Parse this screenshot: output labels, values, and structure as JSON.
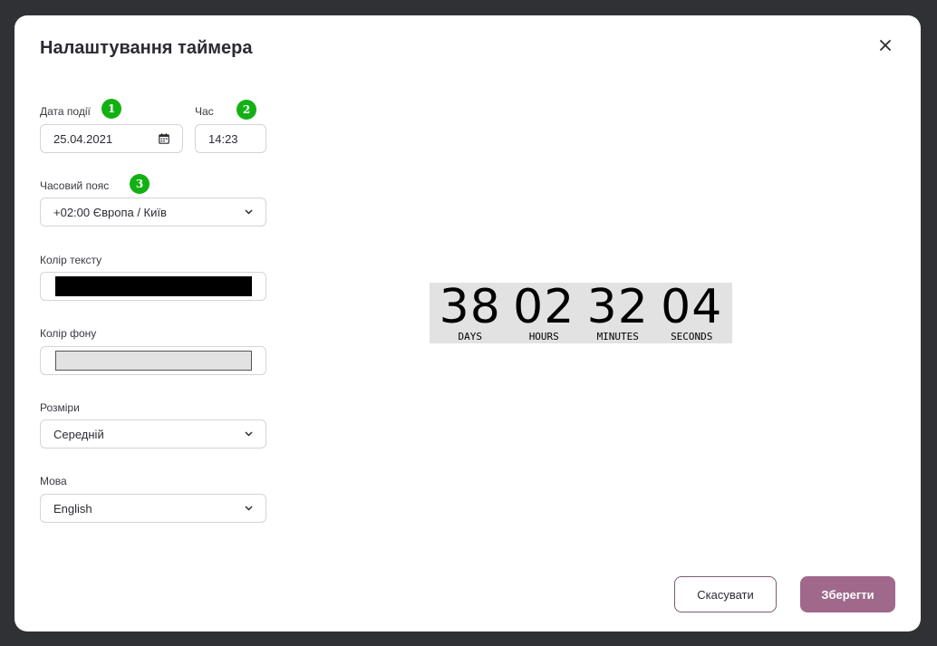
{
  "modal": {
    "title": "Налаштування таймера",
    "close_icon": "close-icon"
  },
  "form": {
    "date": {
      "label": "Дата події",
      "badge": "1",
      "value": "25.04.2021",
      "icon": "calendar-icon"
    },
    "time": {
      "label": "Час",
      "badge": "2",
      "value": "14:23"
    },
    "timezone": {
      "label": "Часовий пояс",
      "badge": "3",
      "value": "+02:00 Європа / Київ",
      "icon": "chevron-down-icon"
    },
    "text_color": {
      "label": "Колір тексту",
      "color": "#000000"
    },
    "bg_color": {
      "label": "Колір фону",
      "color": "#e2e2e2"
    },
    "size": {
      "label": "Розміри",
      "value": "Середній",
      "icon": "chevron-down-icon"
    },
    "language": {
      "label": "Мова",
      "value": "English",
      "icon": "chevron-down-icon"
    }
  },
  "preview": {
    "background": "#e2e2e2",
    "text_color": "#000000",
    "units": [
      {
        "value": "38",
        "label": "DAYS"
      },
      {
        "value": "02",
        "label": "HOURS"
      },
      {
        "value": "32",
        "label": "MINUTES"
      },
      {
        "value": "04",
        "label": "SECONDS"
      }
    ]
  },
  "actions": {
    "cancel_label": "Скасувати",
    "save_label": "Зберегти",
    "save_color": "#a0698b"
  },
  "colors": {
    "badge": "#13b013",
    "overlay": "#2f3134"
  }
}
